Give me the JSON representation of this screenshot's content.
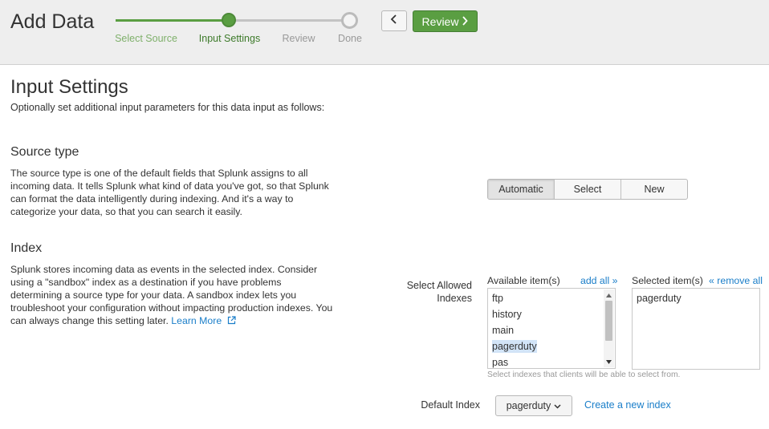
{
  "header": {
    "title": "Add Data",
    "steps": [
      {
        "label": "Select Source",
        "state": "completed"
      },
      {
        "label": "Input Settings",
        "state": "current"
      },
      {
        "label": "Review",
        "state": "pending"
      },
      {
        "label": "Done",
        "state": "pending"
      }
    ],
    "back_icon": "chevron-left-icon",
    "review_button": "Review",
    "review_icon": "chevron-right-icon"
  },
  "page": {
    "title": "Input Settings",
    "subtitle": "Optionally set additional input parameters for this data input as follows:"
  },
  "source_type": {
    "heading": "Source type",
    "description": "The source type is one of the default fields that Splunk assigns to all incoming data. It tells Splunk what kind of data you've got, so that Splunk can format the data intelligently during indexing. And it's a way to categorize your data, so that you can search it easily.",
    "options": [
      "Automatic",
      "Select",
      "New"
    ],
    "selected": "Automatic"
  },
  "index": {
    "heading": "Index",
    "description": "Splunk stores incoming data as events in the selected index. Consider using a \"sandbox\" index as a destination if you have problems determining a source type for your data. A sandbox index lets you troubleshoot your configuration without impacting production indexes. You can always change this setting later.",
    "learn_more": "Learn More",
    "learn_more_icon": "external-link-icon",
    "allowed_label": "Select Allowed Indexes",
    "available_header": "Available item(s)",
    "add_all": "add all »",
    "available_items": [
      "ftp",
      "history",
      "main",
      "pagerduty",
      "pas"
    ],
    "highlighted_item": "pagerduty",
    "selected_header": "Selected item(s)",
    "remove_all": "« remove all",
    "selected_items": [
      "pagerduty"
    ],
    "helper_text": "Select indexes that clients will be able to select from.",
    "default_label": "Default Index",
    "default_value": "pagerduty",
    "create_link": "Create a new index"
  },
  "colors": {
    "accent_green": "#5a9e42",
    "link_blue": "#1a7ec9",
    "highlight_blue": "#d2e4f7"
  }
}
